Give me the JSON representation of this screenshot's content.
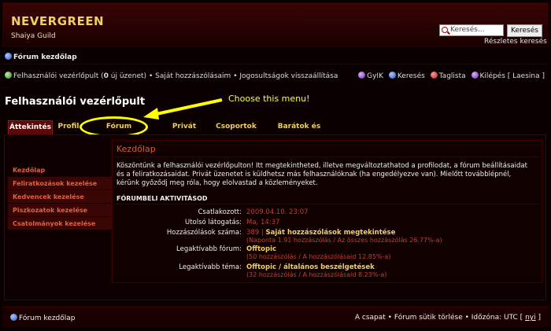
{
  "header": {
    "site_title": "NEVERGREEN",
    "site_subtitle": "Shaiya Guild",
    "search_placeholder": "Keresés...",
    "search_button": "Keresés",
    "advanced_search": "Részletes keresés"
  },
  "breadcrumb": {
    "label": "Fórum kezdőlap"
  },
  "navbar": {
    "ucp": "Felhasználói vezérlőpult",
    "new_messages": "(0 új üzenet)",
    "own_posts": "Saját hozzászólásaim",
    "reset_perms": "Jogosultságok visszaállítása",
    "faq": "GyIK",
    "search": "Keresés",
    "members": "Taglista",
    "logout": "Kilépés [ Laesina ]"
  },
  "page_title": "Felhasználói vezérlőpult",
  "annotation": "Choose this menu!",
  "tabs": [
    {
      "label": "Áttekintés",
      "active": true
    },
    {
      "label": "Profil",
      "active": false
    },
    {
      "label": "Fórum beállítások",
      "active": false
    },
    {
      "label": "Privát üzenetek",
      "active": false
    },
    {
      "label": "Csoportok",
      "active": false
    },
    {
      "label": "Barátok és haragosok",
      "active": false
    }
  ],
  "sidebar": [
    {
      "label": "Kezdőlap"
    },
    {
      "label": "Feliratkozások kezelése"
    },
    {
      "label": "Kedvencek kezelése"
    },
    {
      "label": "Piszkozatok kezelése"
    },
    {
      "label": "Csatolmányok kezelése"
    }
  ],
  "content": {
    "title": "Kezdőlap",
    "intro": "Köszöntünk a felhasználói vezérlőpulton! Itt megtekintheted, illetve megváltoztathatod a profilodat, a fórum beállításaidat és a feliratkozásaidat. Privát üzenetet is küldhetsz más felhasználóknak (ha engedélyezve van). Mielőtt továbblépnél, kérünk győződj meg róla, hogy elolvastad a közleményeket.",
    "activity_title": "FÓRUMBELI AKTIVITÁSOD",
    "rows": [
      {
        "label": "Csatlakozott:",
        "value": "2009.04.10. 23:07"
      },
      {
        "label": "Utolsó látogatás:",
        "value": "Ma, 14:37"
      },
      {
        "label": "Hozzászólások száma:",
        "value_num": "389",
        "value_link": "Saját hozzászólások megtekintése",
        "sub": "(Naponta 1.91 hozzászólás / Az összes hozzászólás 26.77%-a)"
      },
      {
        "label": "Legaktívabb fórum:",
        "value_link": "Offtopic",
        "sub": "(50 hozzászólás / A hozzászólásaid 12.85%-a)"
      },
      {
        "label": "Legaktívabb téma:",
        "value_link": "Offtopic / általános beszélgetések",
        "sub": "(32 hozzászólás / A hozzászólásaid 8.23%-a)"
      }
    ]
  },
  "footer": {
    "home": "Fórum kezdőlap",
    "team": "A csapat",
    "delete_cookies": "Fórum sütik törlése",
    "timezone": "Időzóna: UTC [",
    "dst": "nyi",
    "close": "]"
  }
}
